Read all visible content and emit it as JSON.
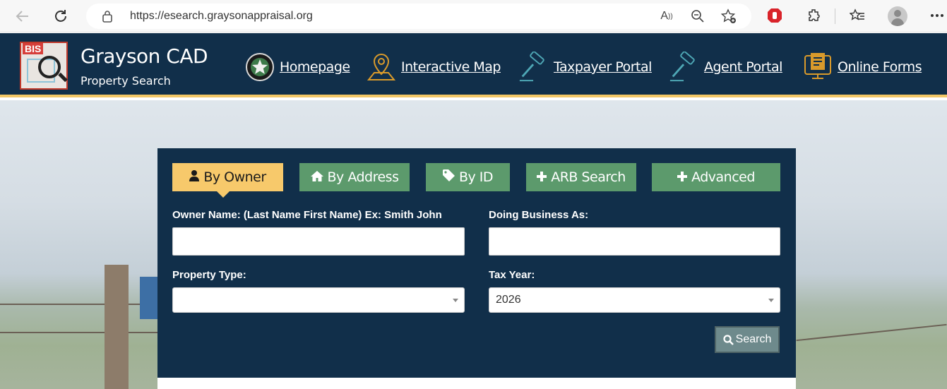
{
  "browser": {
    "url": "https://esearch.graysonappraisal.org"
  },
  "header": {
    "logo_text": "BIS",
    "title": "Grayson CAD",
    "subtitle": "Property Search",
    "nav": [
      {
        "label": "Homepage",
        "icon": "star-seal-icon"
      },
      {
        "label": "Interactive Map",
        "icon": "map-pin-icon"
      },
      {
        "label": "Taxpayer Portal",
        "icon": "gavel-icon"
      },
      {
        "label": "Agent Portal",
        "icon": "gavel-icon"
      },
      {
        "label": "Online Forms",
        "icon": "forms-icon"
      }
    ]
  },
  "search": {
    "tabs": [
      {
        "label": "By Owner",
        "icon": "user-icon",
        "active": true
      },
      {
        "label": "By Address",
        "icon": "home-icon",
        "active": false
      },
      {
        "label": "By ID",
        "icon": "tag-icon",
        "active": false
      },
      {
        "label": "ARB Search",
        "icon": "plus-icon",
        "active": false
      },
      {
        "label": "Advanced",
        "icon": "plus-icon",
        "active": false
      }
    ],
    "owner_label": "Owner Name: (Last Name First Name) Ex: Smith John",
    "owner_value": "",
    "dba_label": "Doing Business As:",
    "dba_value": "",
    "property_type_label": "Property Type:",
    "property_type_value": "",
    "tax_year_label": "Tax Year:",
    "tax_year_value": "2026",
    "search_button": "Search"
  },
  "colors": {
    "navy": "#112f4a",
    "active_tab": "#f7c96b",
    "tab_green": "#5c9a6c",
    "accent_border": "#f2c766"
  }
}
